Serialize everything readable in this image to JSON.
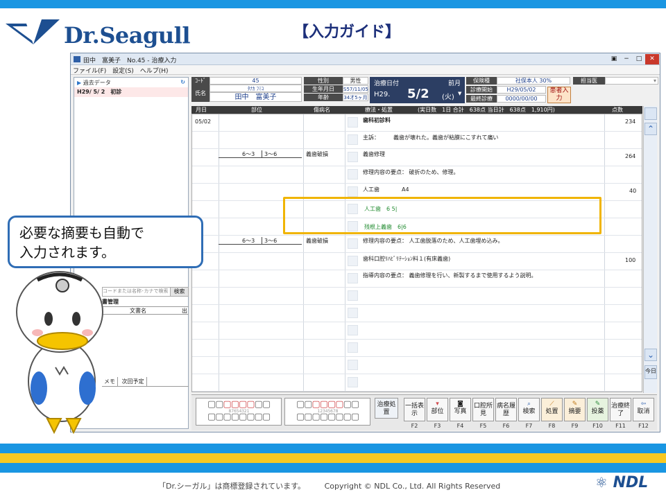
{
  "slide": {
    "title": "【入力ガイド】",
    "brand": "Dr.Seagull",
    "callout_line1": "必要な摘要も自動で",
    "callout_line2": "入力されます。",
    "footer_trademark": "「Dr.シーガル」は商標登録されています。",
    "footer_copyright": "Copyright © NDL Co., Ltd. All Rights Reserved",
    "footer_logo": "NDL"
  },
  "window": {
    "title": "田中　富美子　No.45 - 治療入力",
    "menu": [
      "ファイル(F)",
      "設定(S)",
      "ヘルプ(H)"
    ]
  },
  "left_pane": {
    "history_label": "過去データ",
    "history_entry": "H29/ 5/ 2　初診",
    "search_placeholder": "コードまたは名称･カナで検索",
    "search_button": "検索",
    "doc_header": "書管理",
    "doc_col": "文書名",
    "doc_col2": "出",
    "tab_memo": "メモ",
    "tab_next": "次回予定"
  },
  "patient": {
    "code_label": "ｺｰﾄﾞ",
    "code": "45",
    "name_label": "氏名",
    "kana": "ﾀﾅｶ ﾌﾐｺ",
    "name": "田中　富美子",
    "sex_label": "性別",
    "sex": "男性",
    "dob_label": "生年月日",
    "dob": "S57/11/05",
    "age_label": "年齢",
    "age": "34才5ヶ月",
    "treat_date_label": "治療日付",
    "prev_month": "前月",
    "era": "H29.",
    "date": "5/2",
    "weekday": "(火)",
    "insurance_label": "保険種",
    "insurance": "社保本人 30%",
    "start_label": "診療開始",
    "start": "H29/05/02",
    "last_label": "最終診療",
    "last": "0000/00/00",
    "doctor_label": "担当医",
    "patient_button": "患者入力"
  },
  "grid": {
    "headers": {
      "date": "月日",
      "site": "部位",
      "disease": "傷病名",
      "treatment": "療法・処置",
      "summary": "(実日数　1日 合計　638点 当日計　638点　1,910円)",
      "points": "点数"
    },
    "rows": [
      {
        "date": "05/02",
        "text": "歯科初診料",
        "points": "234"
      },
      {
        "text": "主訴：　　　義歯が壊れた。義歯が粘膜にこすれて痛い"
      },
      {
        "site_l": "6～3",
        "site_r": "3～6",
        "disease": "義歯破損",
        "text": "義歯修理",
        "points": "264"
      },
      {
        "text": "修理内容の要点：  破折のため、修理。"
      },
      {
        "text": "人工歯　　　　A4",
        "points": "40"
      },
      {
        "text": "人工歯　6 5|",
        "green": true
      },
      {
        "text": "残根上義歯　6|6",
        "green": true
      },
      {
        "site_l": "6～3",
        "site_r": "3～6",
        "disease": "義歯破損",
        "text": "修理内容の要点：  人工歯脱落のため、人工歯埋め込み。"
      },
      {
        "text": "歯科口腔ﾘﾊﾋﾞﾘﾃｰｼｮﾝ料１(有床義歯)",
        "points": "100"
      },
      {
        "text": "指導内容の要点：  義歯修理を行い、新製するまで使用するよう説明。"
      }
    ]
  },
  "scrollbar": {
    "today": "今日"
  },
  "fkeys": [
    {
      "label": "治療処置",
      "key": ""
    },
    {
      "label": "一括表示",
      "key": "F2"
    },
    {
      "label": "部位",
      "key": "F3"
    },
    {
      "label": "写真",
      "key": "F4"
    },
    {
      "label": "口腔所見",
      "key": "F5"
    },
    {
      "label": "病名履歴",
      "key": "F6"
    },
    {
      "label": "検索",
      "key": "F7"
    },
    {
      "label": "処置",
      "key": "F8"
    },
    {
      "label": "摘要",
      "key": "F9"
    },
    {
      "label": "投薬",
      "key": "F10"
    },
    {
      "label": "治療終了",
      "key": "F11"
    },
    {
      "label": "取消",
      "key": "F12"
    }
  ],
  "teeth_chart": {
    "upper_left": "8 7 6 5 4 3 2 1",
    "upper_right": "1 2 3 4 5 6 7 8"
  }
}
